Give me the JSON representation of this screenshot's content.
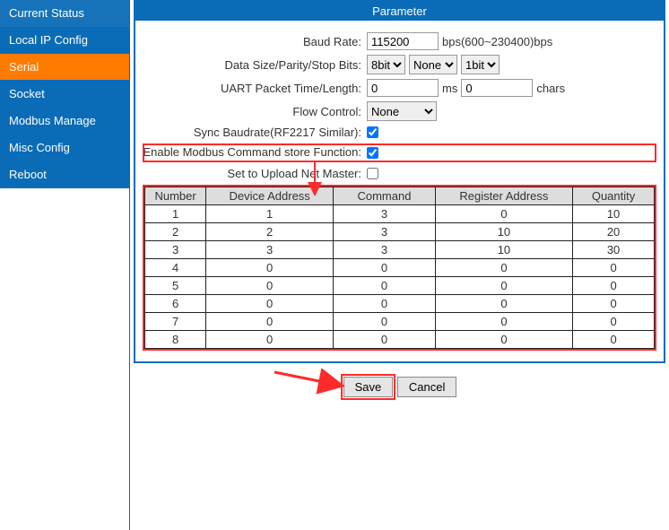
{
  "sidebar": {
    "items": [
      {
        "label": "Current Status",
        "name": "sidebar-item-current-status"
      },
      {
        "label": "Local IP Config",
        "name": "sidebar-item-local-ip-config"
      },
      {
        "label": "Serial",
        "name": "sidebar-item-serial"
      },
      {
        "label": "Socket",
        "name": "sidebar-item-socket"
      },
      {
        "label": "Modbus Manage",
        "name": "sidebar-item-modbus-manage"
      },
      {
        "label": "Misc Config",
        "name": "sidebar-item-misc-config"
      },
      {
        "label": "Reboot",
        "name": "sidebar-item-reboot"
      }
    ],
    "active_index": 2
  },
  "panel": {
    "title": "Parameter",
    "baud_rate": {
      "label": "Baud Rate:",
      "value": "115200",
      "suffix": "bps(600~230400)bps"
    },
    "data_bits": {
      "label": "Data Size/Parity/Stop Bits:",
      "size": "8bit",
      "parity": "None",
      "stop": "1bit"
    },
    "uart_packet": {
      "label": "UART Packet Time/Length:",
      "time": "0",
      "time_unit": "ms",
      "length": "0",
      "length_unit": "chars"
    },
    "flow_control": {
      "label": "Flow Control:",
      "value": "None"
    },
    "sync_baud": {
      "label": "Sync Baudrate(RF2217 Similar):",
      "checked": true
    },
    "enable_modbus": {
      "label": "Enable Modbus Command store Function:",
      "checked": true
    },
    "upload_master": {
      "label": "Set to Upload Net Master:",
      "checked": false
    }
  },
  "table": {
    "headers": [
      "Number",
      "Device Address",
      "Command",
      "Register Address",
      "Quantity"
    ],
    "rows": [
      {
        "number": "1",
        "device_address": "1",
        "command": "3",
        "register_address": "0",
        "quantity": "10"
      },
      {
        "number": "2",
        "device_address": "2",
        "command": "3",
        "register_address": "10",
        "quantity": "20"
      },
      {
        "number": "3",
        "device_address": "3",
        "command": "3",
        "register_address": "10",
        "quantity": "30"
      },
      {
        "number": "4",
        "device_address": "0",
        "command": "0",
        "register_address": "0",
        "quantity": "0"
      },
      {
        "number": "5",
        "device_address": "0",
        "command": "0",
        "register_address": "0",
        "quantity": "0"
      },
      {
        "number": "6",
        "device_address": "0",
        "command": "0",
        "register_address": "0",
        "quantity": "0"
      },
      {
        "number": "7",
        "device_address": "0",
        "command": "0",
        "register_address": "0",
        "quantity": "0"
      },
      {
        "number": "8",
        "device_address": "0",
        "command": "0",
        "register_address": "0",
        "quantity": "0"
      }
    ]
  },
  "buttons": {
    "save": "Save",
    "cancel": "Cancel"
  }
}
